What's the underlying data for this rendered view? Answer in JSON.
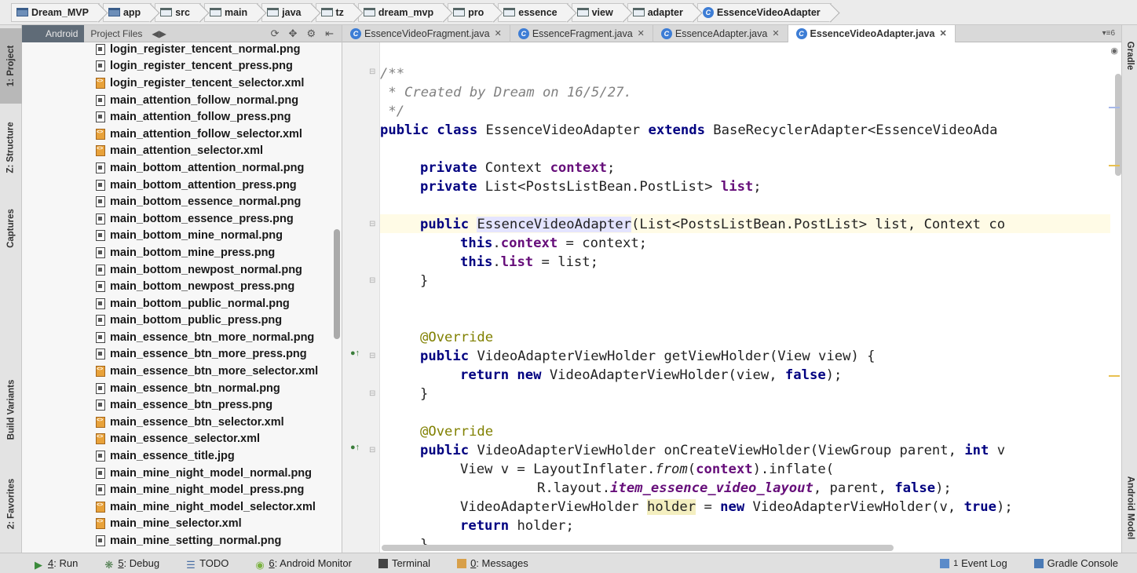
{
  "breadcrumb": [
    {
      "label": "Dream_MVP",
      "icon": "project-folder-icon"
    },
    {
      "label": "app",
      "icon": "module-folder-icon"
    },
    {
      "label": "src",
      "icon": "folder-icon"
    },
    {
      "label": "main",
      "icon": "folder-icon"
    },
    {
      "label": "java",
      "icon": "source-folder-icon"
    },
    {
      "label": "tz",
      "icon": "package-icon"
    },
    {
      "label": "dream_mvp",
      "icon": "package-icon"
    },
    {
      "label": "pro",
      "icon": "package-icon"
    },
    {
      "label": "essence",
      "icon": "package-icon"
    },
    {
      "label": "view",
      "icon": "package-icon"
    },
    {
      "label": "adapter",
      "icon": "package-icon"
    },
    {
      "label": "EssenceVideoAdapter",
      "icon": "class-icon"
    }
  ],
  "left_tools": {
    "project": "1: Project",
    "structure": "Z: Structure",
    "captures": "Captures",
    "build_variants": "Build Variants",
    "favorites": "2: Favorites"
  },
  "right_tools": {
    "gradle": "Gradle",
    "android_model": "Android Model"
  },
  "project_panel": {
    "tab_android": "Android",
    "tab_project_files": "Project Files",
    "files": [
      {
        "name": "login_register_tencent_normal.png",
        "type": "png"
      },
      {
        "name": "login_register_tencent_press.png",
        "type": "png"
      },
      {
        "name": "login_register_tencent_selector.xml",
        "type": "xml"
      },
      {
        "name": "main_attention_follow_normal.png",
        "type": "png"
      },
      {
        "name": "main_attention_follow_press.png",
        "type": "png"
      },
      {
        "name": "main_attention_follow_selector.xml",
        "type": "xml"
      },
      {
        "name": "main_attention_selector.xml",
        "type": "xml"
      },
      {
        "name": "main_bottom_attention_normal.png",
        "type": "png"
      },
      {
        "name": "main_bottom_attention_press.png",
        "type": "png"
      },
      {
        "name": "main_bottom_essence_normal.png",
        "type": "png"
      },
      {
        "name": "main_bottom_essence_press.png",
        "type": "png"
      },
      {
        "name": "main_bottom_mine_normal.png",
        "type": "png"
      },
      {
        "name": "main_bottom_mine_press.png",
        "type": "png"
      },
      {
        "name": "main_bottom_newpost_normal.png",
        "type": "png"
      },
      {
        "name": "main_bottom_newpost_press.png",
        "type": "png"
      },
      {
        "name": "main_bottom_public_normal.png",
        "type": "png"
      },
      {
        "name": "main_bottom_public_press.png",
        "type": "png"
      },
      {
        "name": "main_essence_btn_more_normal.png",
        "type": "png"
      },
      {
        "name": "main_essence_btn_more_press.png",
        "type": "png"
      },
      {
        "name": "main_essence_btn_more_selector.xml",
        "type": "xml"
      },
      {
        "name": "main_essence_btn_normal.png",
        "type": "png"
      },
      {
        "name": "main_essence_btn_press.png",
        "type": "png"
      },
      {
        "name": "main_essence_btn_selector.xml",
        "type": "xml"
      },
      {
        "name": "main_essence_selector.xml",
        "type": "xml"
      },
      {
        "name": "main_essence_title.jpg",
        "type": "png"
      },
      {
        "name": "main_mine_night_model_normal.png",
        "type": "png"
      },
      {
        "name": "main_mine_night_model_press.png",
        "type": "png"
      },
      {
        "name": "main_mine_night_model_selector.xml",
        "type": "xml"
      },
      {
        "name": "main_mine_selector.xml",
        "type": "xml"
      },
      {
        "name": "main_mine_setting_normal.png",
        "type": "png"
      }
    ]
  },
  "editor_tabs": [
    {
      "label": "EssenceVideoFragment.java",
      "active": false
    },
    {
      "label": "EssenceFragment.java",
      "active": false
    },
    {
      "label": "EssenceAdapter.java",
      "active": false
    },
    {
      "label": "EssenceVideoAdapter.java",
      "active": true
    }
  ],
  "tabs_overflow": "6",
  "code": {
    "l1": "/**",
    "l2": " * Created by Dream on 16/5/27.",
    "l3": " */",
    "l4_kw": "public class",
    "l4_name": " EssenceVideoAdapter ",
    "l4_kw2": "extends",
    "l4_rest": " BaseRecyclerAdapter<EssenceVideoAda",
    "l5_kw": "private",
    "l5_type": " Context ",
    "l5_field": "context",
    "l6_kw": "private",
    "l6_type": " List<PostsListBean.PostList> ",
    "l6_field": "list",
    "l7_kw": "public",
    "l7_ctor": "EssenceVideoAdapter",
    "l7_rest": "(List<PostsListBean.PostList> list, Context co",
    "l8_kw": "this",
    "l8_field": "context",
    "l8_rest": " = context;",
    "l9_kw": "this",
    "l9_field": "list",
    "l9_rest": " = list;",
    "brace": "}",
    "ann": "@Override",
    "l11_kw": "public",
    "l11_rest": " VideoAdapterViewHolder getViewHolder(View view) {",
    "l12_kw": "return new",
    "l12_mid": " VideoAdapterViewHolder(view, ",
    "l12_kw2": "false",
    "l12_end": ");",
    "l15_kw": "public",
    "l15_rest": " VideoAdapterViewHolder onCreateViewHolder(ViewGroup parent, ",
    "l15_kw2": "int",
    "l15_end": " v",
    "l16_a": "View v = LayoutInflater.",
    "l16_it": "from",
    "l16_b": "(",
    "l16_field": "context",
    "l16_c": ").inflate(",
    "l17_a": "R.layout.",
    "l17_it": "item_essence_video_layout",
    "l17_b": ", parent, ",
    "l17_kw": "false",
    "l17_c": ");",
    "l18_a": "VideoAdapterViewHolder ",
    "l18_hl": "holder",
    "l18_b": " = ",
    "l18_kw": "new",
    "l18_c": " VideoAdapterViewHolder(v, ",
    "l18_kw2": "true",
    "l18_d": ");",
    "l19_kw": "return",
    "l19_rest": " holder;",
    "last_brace": "}"
  },
  "bottom_bar": {
    "run_key": "4",
    "run": ": Run",
    "debug_key": "5",
    "debug": ": Debug",
    "todo": "TODO",
    "monitor_key": "6",
    "monitor": ": Android Monitor",
    "terminal": "Terminal",
    "messages_key": "0",
    "messages": ": Messages",
    "event_log": "Event Log",
    "event_log_count": "1",
    "gradle_console": "Gradle Console"
  }
}
